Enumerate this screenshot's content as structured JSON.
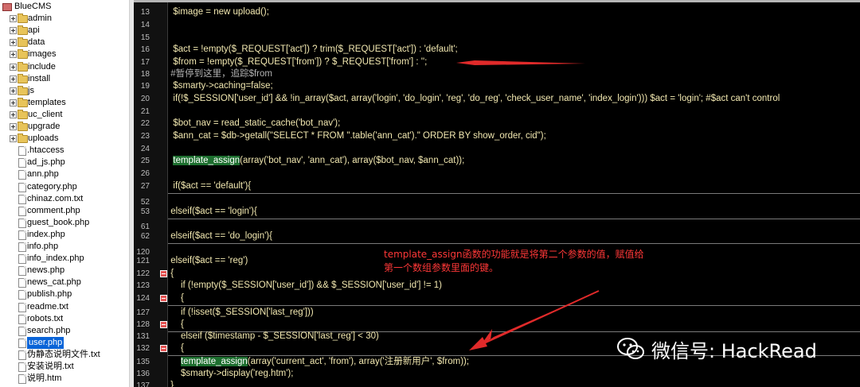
{
  "file_tree": {
    "root_label": "BlueCMS",
    "folders": [
      "admin",
      "api",
      "data",
      "images",
      "include",
      "install",
      "js",
      "templates",
      "uc_client",
      "upgrade",
      "uploads"
    ],
    "files": [
      ".htaccess",
      "ad_js.php",
      "ann.php",
      "category.php",
      "chinaz.com.txt",
      "comment.php",
      "guest_book.php",
      "index.php",
      "info.php",
      "info_index.php",
      "news.php",
      "news_cat.php",
      "publish.php",
      "readme.txt",
      "robots.txt",
      "search.php",
      "user.php",
      "伪静态说明文件.txt",
      "安装说明.txt",
      "说明.htm"
    ],
    "selected_file": "user.php"
  },
  "editor": {
    "lines": [
      {
        "num": "13",
        "text": "  $image = new upload();"
      },
      {
        "num": "14",
        "text": ""
      },
      {
        "num": "15",
        "text": ""
      },
      {
        "num": "16",
        "text": "  $act = !empty($_REQUEST['act']) ? trim($_REQUEST['act']) : 'default';"
      },
      {
        "num": "17",
        "text": "  $from = !empty($_REQUEST['from']) ? $_REQUEST['from'] : '';"
      },
      {
        "num": "18",
        "text": " #暂停到这里，追踪$from"
      },
      {
        "num": "19",
        "text": "  $smarty->caching=false;"
      },
      {
        "num": "20",
        "text": "  if(!$_SESSION['user_id'] && !in_array($act, array('login', 'do_login', 'reg', 'do_reg', 'check_user_name', 'index_login'))) $act = 'login'; #$act can't control"
      },
      {
        "num": "21",
        "text": ""
      },
      {
        "num": "22",
        "text": "  $bot_nav = read_static_cache('bot_nav');"
      },
      {
        "num": "23",
        "text": "  $ann_cat = $db->getall(\"SELECT * FROM \".table('ann_cat').\" ORDER BY show_order, cid\");"
      },
      {
        "num": "24",
        "text": ""
      },
      {
        "num": "25",
        "text": "  template_assign(array('bot_nav', 'ann_cat'), array($bot_nav, $ann_cat));"
      },
      {
        "num": "26",
        "text": ""
      },
      {
        "num": "27",
        "text": "  if($act == 'default'){"
      },
      {
        "num": "52",
        "text": ""
      },
      {
        "num": "53",
        "text": " elseif($act == 'login'){"
      },
      {
        "num": "61",
        "text": ""
      },
      {
        "num": "62",
        "text": " elseif($act == 'do_login'){"
      },
      {
        "num": "120",
        "text": ""
      },
      {
        "num": "121",
        "text": " elseif($act == 'reg')"
      },
      {
        "num": "122",
        "text": " {"
      },
      {
        "num": "123",
        "text": "     if (!empty($_SESSION['user_id']) && $_SESSION['user_id'] != 1)"
      },
      {
        "num": "124",
        "text": "     {"
      },
      {
        "num": "127",
        "text": "     if (!isset($_SESSION['last_reg']))"
      },
      {
        "num": "128",
        "text": "     {"
      },
      {
        "num": "131",
        "text": "     elseif ($timestamp - $_SESSION['last_reg'] < 30)"
      },
      {
        "num": "132",
        "text": "     {"
      },
      {
        "num": "135",
        "text": "     template_assign(array('current_act', 'from'), array('注册新用户', $from));"
      },
      {
        "num": "136",
        "text": "     $smarty->display('reg.htm');"
      },
      {
        "num": "137",
        "text": " }"
      }
    ],
    "highlight_token": "template_assign",
    "comment_prefix": "#"
  },
  "annotation": {
    "line1": "template_assign函数的功能就是将第二个参数的值，赋值给",
    "line2": "第一个数组参数里面的键。"
  },
  "watermark": {
    "text": "微信号: HackRead",
    "icon": "wechat-icon"
  },
  "colors": {
    "editor_bg": "#000000",
    "code_text": "#f2e8b0",
    "highlight_bg": "#1d6f2f",
    "annotation_red": "#ff3838",
    "selected_bg": "#0a64d8"
  }
}
